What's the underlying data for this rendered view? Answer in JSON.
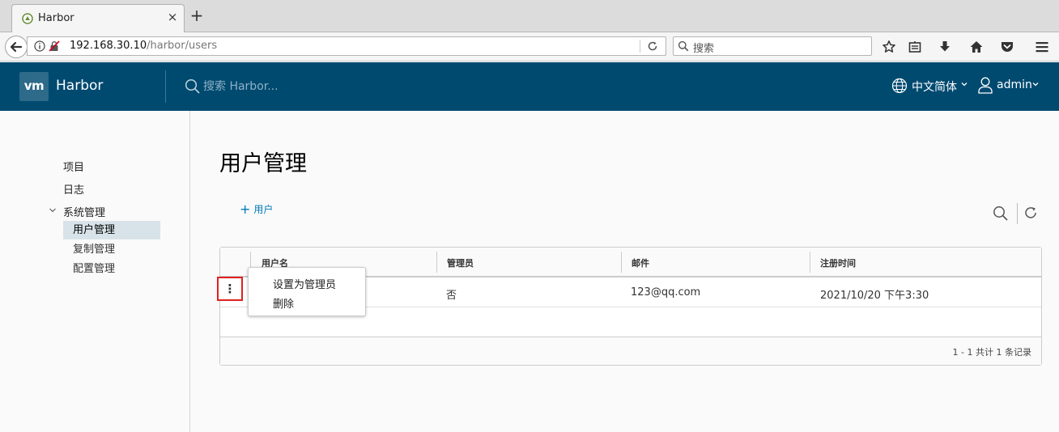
{
  "browser": {
    "tab_title": "Harbor",
    "new_tab": "+",
    "close_tab": "×",
    "url_host": "192.168.30.10",
    "url_path": "/harbor/users",
    "search_placeholder": "搜索"
  },
  "header": {
    "logo_text": "vm",
    "brand": "Harbor",
    "search_placeholder": "搜索 Harbor...",
    "language": "中文简体",
    "user": "admin",
    "color": "#004a70"
  },
  "sidebar": {
    "items": [
      {
        "label": "项目"
      },
      {
        "label": "日志"
      },
      {
        "label": "系统管理"
      }
    ],
    "children": [
      {
        "label": "用户管理",
        "active": true
      },
      {
        "label": "复制管理"
      },
      {
        "label": "配置管理"
      }
    ]
  },
  "main": {
    "title": "用户管理",
    "add_user": "用户",
    "columns": [
      "用户名",
      "管理员",
      "邮件",
      "注册时间"
    ],
    "rows": [
      {
        "username": "",
        "admin": "否",
        "email": "123@qq.com",
        "created": "2021/10/20 下午3:30"
      }
    ],
    "footer": "1 - 1 共计 1 条记录",
    "action_trigger": "⋮"
  },
  "menu": {
    "items": [
      "设置为管理员",
      "删除"
    ]
  }
}
